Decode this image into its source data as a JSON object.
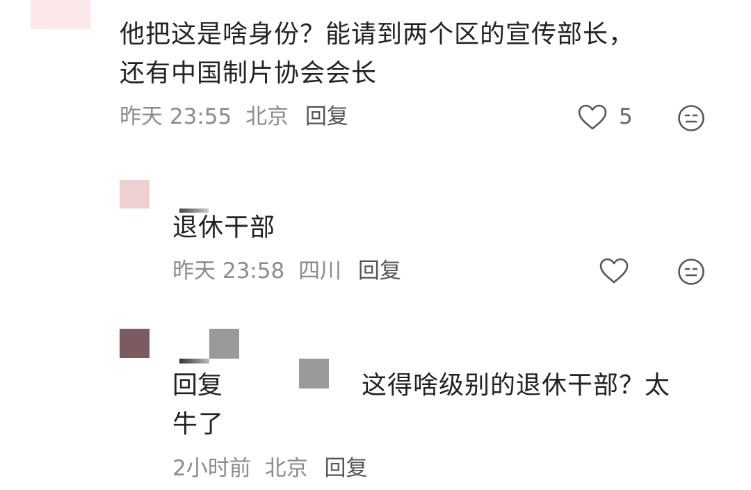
{
  "comments": [
    {
      "text_line1": "他把这是啥身份？能请到两个区的宣传部长，",
      "text_line2": "还有中国制片协会会长",
      "time": "昨天 23:55",
      "location": "北京",
      "reply_label": "回复",
      "like_count": "5"
    },
    {
      "text": "退休干部",
      "time": "昨天 23:58",
      "location": "四川",
      "reply_label": "回复"
    },
    {
      "reply_prefix": "回复",
      "text_line1": "这得啥级别的退休干部？太",
      "text_line2": "牛了",
      "time": "2小时前",
      "location": "北京",
      "reply_label": "回复"
    }
  ],
  "icons": {
    "like": "heart-outline-icon",
    "dislike": "neutral-face-icon"
  },
  "colors": {
    "text": "#222222",
    "meta": "#8b8b8b",
    "icon": "#555555"
  }
}
